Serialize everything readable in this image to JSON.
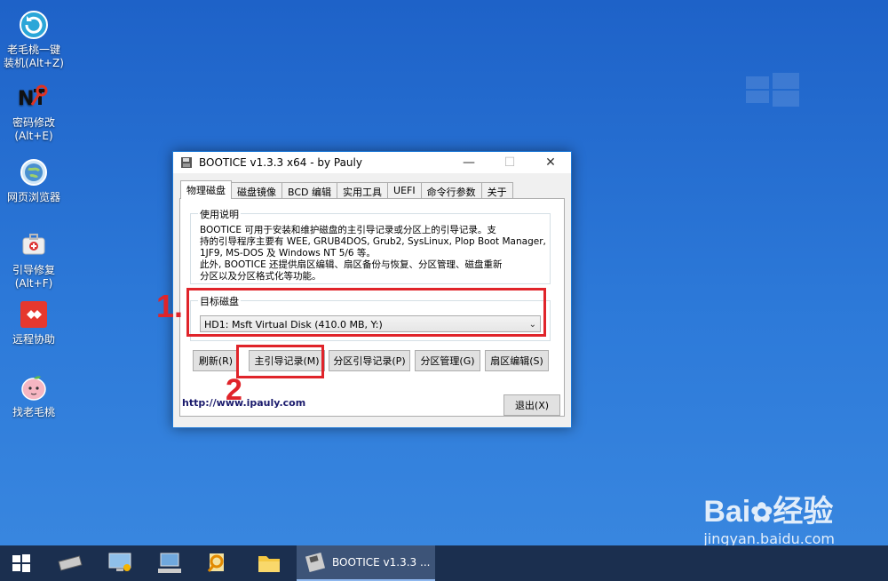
{
  "desktop": {
    "icons": [
      {
        "label": "老毛桃一键\n装机(Alt+Z)",
        "icon": "refresh-install-icon"
      },
      {
        "label": "密码修改\n(Alt+E)",
        "icon": "nt-password-icon"
      },
      {
        "label": "网页浏览器",
        "icon": "globe-icon"
      },
      {
        "label": "引导修复\n(Alt+F)",
        "icon": "first-aid-icon"
      },
      {
        "label": "远程协助",
        "icon": "remote-assist-icon"
      },
      {
        "label": "找老毛桃",
        "icon": "peach-icon"
      }
    ]
  },
  "window": {
    "title": "BOOTICE v1.3.3 x64 - by Pauly",
    "controls": {
      "minimize": "—",
      "maximize": "☐",
      "close": "✕"
    },
    "tabs": [
      "物理磁盘",
      "磁盘镜像",
      "BCD 编辑",
      "实用工具",
      "UEFI",
      "命令行参数",
      "关于"
    ],
    "active_tab": 0,
    "usage": {
      "title": "使用说明",
      "lines": [
        "BOOTICE 可用于安装和维护磁盘的主引导记录或分区上的引导记录。支",
        "持的引导程序主要有 WEE, GRUB4DOS, Grub2, SysLinux, Plop Boot Manager,",
        "1JF9, MS-DOS 及 Windows NT 5/6 等。",
        "此外, BOOTICE 还提供扇区编辑、扇区备份与恢复、分区管理、磁盘重新",
        "分区以及分区格式化等功能。"
      ]
    },
    "target_disk": {
      "title": "目标磁盘",
      "selected": "HD1: Msft Virtual Disk (410.0 MB, Y:)"
    },
    "buttons": {
      "refresh": "刷新(R)",
      "mbr": "主引导记录(M)",
      "pbr": "分区引导记录(P)",
      "parts": "分区管理(G)",
      "sector": "扇区编辑(S)",
      "exit": "退出(X)"
    },
    "link": "http://www.ipauly.com"
  },
  "annotations": {
    "step1": "1.",
    "step2": "2"
  },
  "taskbar": {
    "items": [
      "start-icon",
      "chip-icon",
      "network-computer-icon",
      "monitor-keyboard-icon",
      "search-doc-icon",
      "folder-icon"
    ],
    "active_window": "BOOTICE v1.3.3 ..."
  },
  "watermark": {
    "brand": "Bai",
    "brand_cn": "经验",
    "url": "jingyan.baidu.com"
  },
  "colors": {
    "accent_red": "#e0242a",
    "window_border": "#1c77d6",
    "taskbar": "#1b2f4f"
  }
}
